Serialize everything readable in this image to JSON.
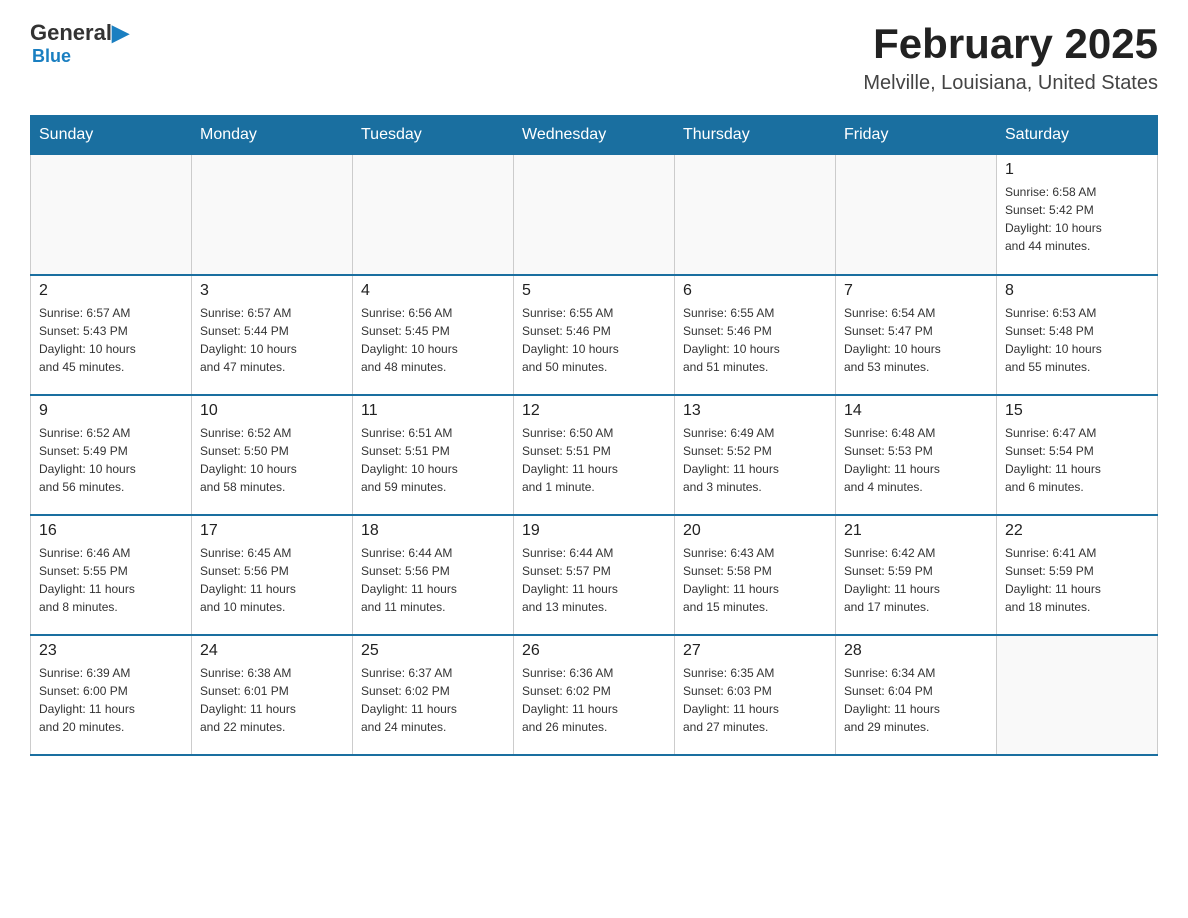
{
  "logo": {
    "general": "General",
    "blue": "Blue",
    "tagline": "Blue"
  },
  "header": {
    "title": "February 2025",
    "subtitle": "Melville, Louisiana, United States"
  },
  "days_of_week": [
    "Sunday",
    "Monday",
    "Tuesday",
    "Wednesday",
    "Thursday",
    "Friday",
    "Saturday"
  ],
  "weeks": [
    [
      {
        "day": "",
        "info": ""
      },
      {
        "day": "",
        "info": ""
      },
      {
        "day": "",
        "info": ""
      },
      {
        "day": "",
        "info": ""
      },
      {
        "day": "",
        "info": ""
      },
      {
        "day": "",
        "info": ""
      },
      {
        "day": "1",
        "info": "Sunrise: 6:58 AM\nSunset: 5:42 PM\nDaylight: 10 hours\nand 44 minutes."
      }
    ],
    [
      {
        "day": "2",
        "info": "Sunrise: 6:57 AM\nSunset: 5:43 PM\nDaylight: 10 hours\nand 45 minutes."
      },
      {
        "day": "3",
        "info": "Sunrise: 6:57 AM\nSunset: 5:44 PM\nDaylight: 10 hours\nand 47 minutes."
      },
      {
        "day": "4",
        "info": "Sunrise: 6:56 AM\nSunset: 5:45 PM\nDaylight: 10 hours\nand 48 minutes."
      },
      {
        "day": "5",
        "info": "Sunrise: 6:55 AM\nSunset: 5:46 PM\nDaylight: 10 hours\nand 50 minutes."
      },
      {
        "day": "6",
        "info": "Sunrise: 6:55 AM\nSunset: 5:46 PM\nDaylight: 10 hours\nand 51 minutes."
      },
      {
        "day": "7",
        "info": "Sunrise: 6:54 AM\nSunset: 5:47 PM\nDaylight: 10 hours\nand 53 minutes."
      },
      {
        "day": "8",
        "info": "Sunrise: 6:53 AM\nSunset: 5:48 PM\nDaylight: 10 hours\nand 55 minutes."
      }
    ],
    [
      {
        "day": "9",
        "info": "Sunrise: 6:52 AM\nSunset: 5:49 PM\nDaylight: 10 hours\nand 56 minutes."
      },
      {
        "day": "10",
        "info": "Sunrise: 6:52 AM\nSunset: 5:50 PM\nDaylight: 10 hours\nand 58 minutes."
      },
      {
        "day": "11",
        "info": "Sunrise: 6:51 AM\nSunset: 5:51 PM\nDaylight: 10 hours\nand 59 minutes."
      },
      {
        "day": "12",
        "info": "Sunrise: 6:50 AM\nSunset: 5:51 PM\nDaylight: 11 hours\nand 1 minute."
      },
      {
        "day": "13",
        "info": "Sunrise: 6:49 AM\nSunset: 5:52 PM\nDaylight: 11 hours\nand 3 minutes."
      },
      {
        "day": "14",
        "info": "Sunrise: 6:48 AM\nSunset: 5:53 PM\nDaylight: 11 hours\nand 4 minutes."
      },
      {
        "day": "15",
        "info": "Sunrise: 6:47 AM\nSunset: 5:54 PM\nDaylight: 11 hours\nand 6 minutes."
      }
    ],
    [
      {
        "day": "16",
        "info": "Sunrise: 6:46 AM\nSunset: 5:55 PM\nDaylight: 11 hours\nand 8 minutes."
      },
      {
        "day": "17",
        "info": "Sunrise: 6:45 AM\nSunset: 5:56 PM\nDaylight: 11 hours\nand 10 minutes."
      },
      {
        "day": "18",
        "info": "Sunrise: 6:44 AM\nSunset: 5:56 PM\nDaylight: 11 hours\nand 11 minutes."
      },
      {
        "day": "19",
        "info": "Sunrise: 6:44 AM\nSunset: 5:57 PM\nDaylight: 11 hours\nand 13 minutes."
      },
      {
        "day": "20",
        "info": "Sunrise: 6:43 AM\nSunset: 5:58 PM\nDaylight: 11 hours\nand 15 minutes."
      },
      {
        "day": "21",
        "info": "Sunrise: 6:42 AM\nSunset: 5:59 PM\nDaylight: 11 hours\nand 17 minutes."
      },
      {
        "day": "22",
        "info": "Sunrise: 6:41 AM\nSunset: 5:59 PM\nDaylight: 11 hours\nand 18 minutes."
      }
    ],
    [
      {
        "day": "23",
        "info": "Sunrise: 6:39 AM\nSunset: 6:00 PM\nDaylight: 11 hours\nand 20 minutes."
      },
      {
        "day": "24",
        "info": "Sunrise: 6:38 AM\nSunset: 6:01 PM\nDaylight: 11 hours\nand 22 minutes."
      },
      {
        "day": "25",
        "info": "Sunrise: 6:37 AM\nSunset: 6:02 PM\nDaylight: 11 hours\nand 24 minutes."
      },
      {
        "day": "26",
        "info": "Sunrise: 6:36 AM\nSunset: 6:02 PM\nDaylight: 11 hours\nand 26 minutes."
      },
      {
        "day": "27",
        "info": "Sunrise: 6:35 AM\nSunset: 6:03 PM\nDaylight: 11 hours\nand 27 minutes."
      },
      {
        "day": "28",
        "info": "Sunrise: 6:34 AM\nSunset: 6:04 PM\nDaylight: 11 hours\nand 29 minutes."
      },
      {
        "day": "",
        "info": ""
      }
    ]
  ]
}
